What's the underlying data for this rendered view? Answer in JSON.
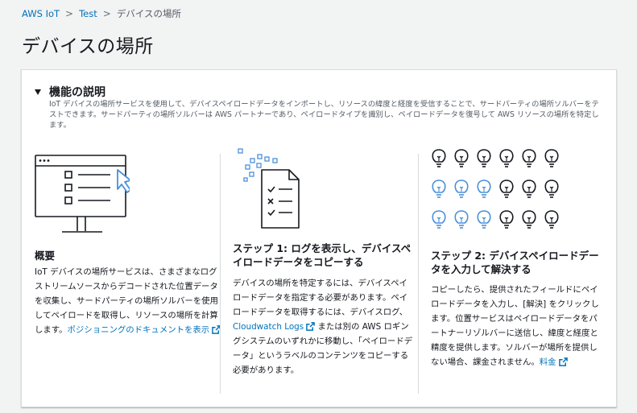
{
  "breadcrumb": {
    "items": [
      "AWS IoT",
      "Test"
    ],
    "current": "デバイスの場所"
  },
  "page": {
    "title": "デバイスの場所"
  },
  "panel": {
    "title": "機能の説明",
    "description": "IoT デバイスの場所サービスを使用して、デバイスペイロードデータをインポートし、リソースの緯度と経度を受信することで、サードパーティの場所ソルバーをテストできます。サードパーティの場所ソルバーは AWS パートナーであり、ペイロードタイプを識別し、ペイロードデータを復号して AWS リソースの場所を特定します。"
  },
  "columns": {
    "overview": {
      "title": "概要",
      "body": "IoT デバイスの場所サービスは、さまざまなログストリームソースからデコードされた位置データを収集し、サードパーティの場所ソルバーを使用してペイロードを取得し、リソースの場所を計算します。",
      "link": "ポジショニングのドキュメントを表示"
    },
    "step1": {
      "title": "ステップ 1: ログを表示し、デバイスペイロードデータをコピーする",
      "body_before": "デバイスの場所を特定するには、デバイスペイロードデータを指定する必要があります。ペイロードデータを取得するには、デバイスログ、",
      "link": "Cloudwatch Logs",
      "body_after": "または別の AWS ロギングシステムのいずれかに移動し、「ペイロードデータ」というラベルのコンテンツをコピーする必要があります。"
    },
    "step2": {
      "title": "ステップ 2: デバイスペイロードデータを入力して解決する",
      "body": "コピーしたら、提供されたフィールドにペイロードデータを入力し、[解決] をクリックします。位置サービスはペイロードデータをパートナーリゾルバーに送信し、緯度と経度と精度を提供します。ソルバーが場所を提供しない場合、課金されません。",
      "link": "料金"
    }
  },
  "colors": {
    "link": "#0073bb",
    "text": "#16191f",
    "muted": "#545b64",
    "bulb_active": "#4a90d9",
    "bulb_inactive": "#16191f"
  },
  "illustrations": {
    "overview": "monitor-checklist-icon",
    "step1": "document-checklist-icon",
    "step2": "lightbulb-grid-icon",
    "bulb_grid_active": [
      [
        0,
        0,
        0,
        0,
        0,
        0
      ],
      [
        1,
        1,
        1,
        0,
        0,
        0
      ],
      [
        1,
        1,
        1,
        0,
        0,
        0
      ]
    ]
  }
}
